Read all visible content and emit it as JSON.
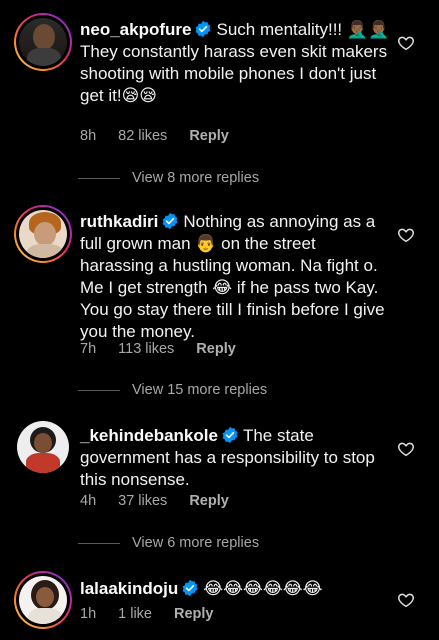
{
  "comments": [
    {
      "username": "neo_akpofure",
      "text": "Such mentality!!! 🤦🏾‍♂️🤦🏾‍♂️ They constantly harass even skit makers shooting with mobile phones I don't just get it!😪😪",
      "time": "8h",
      "likes": "82 likes",
      "reply": "Reply",
      "view_more": "View 8 more replies"
    },
    {
      "username": "ruthkadiri",
      "text": "Nothing as annoying as a full grown man 👨 on the street harassing a hustling woman. Na fight o. Me I get strength 😂 if he pass two Kay. You go stay there till I finish before I give you the money.",
      "time": "7h",
      "likes": "113 likes",
      "reply": "Reply",
      "view_more": "View 15 more replies"
    },
    {
      "username": "_kehindebankole",
      "text": "The state government has a responsibility to stop this nonsense.",
      "time": "4h",
      "likes": "37 likes",
      "reply": "Reply",
      "view_more": "View 6 more replies"
    },
    {
      "username": "lalaakindoju",
      "text": "😂😂😂😂😂😂",
      "time": "1h",
      "likes": "1 like",
      "reply": "Reply"
    }
  ],
  "colors": {
    "background": "#000000",
    "verified": "#0095f6",
    "meta": "#a8a8a8"
  }
}
